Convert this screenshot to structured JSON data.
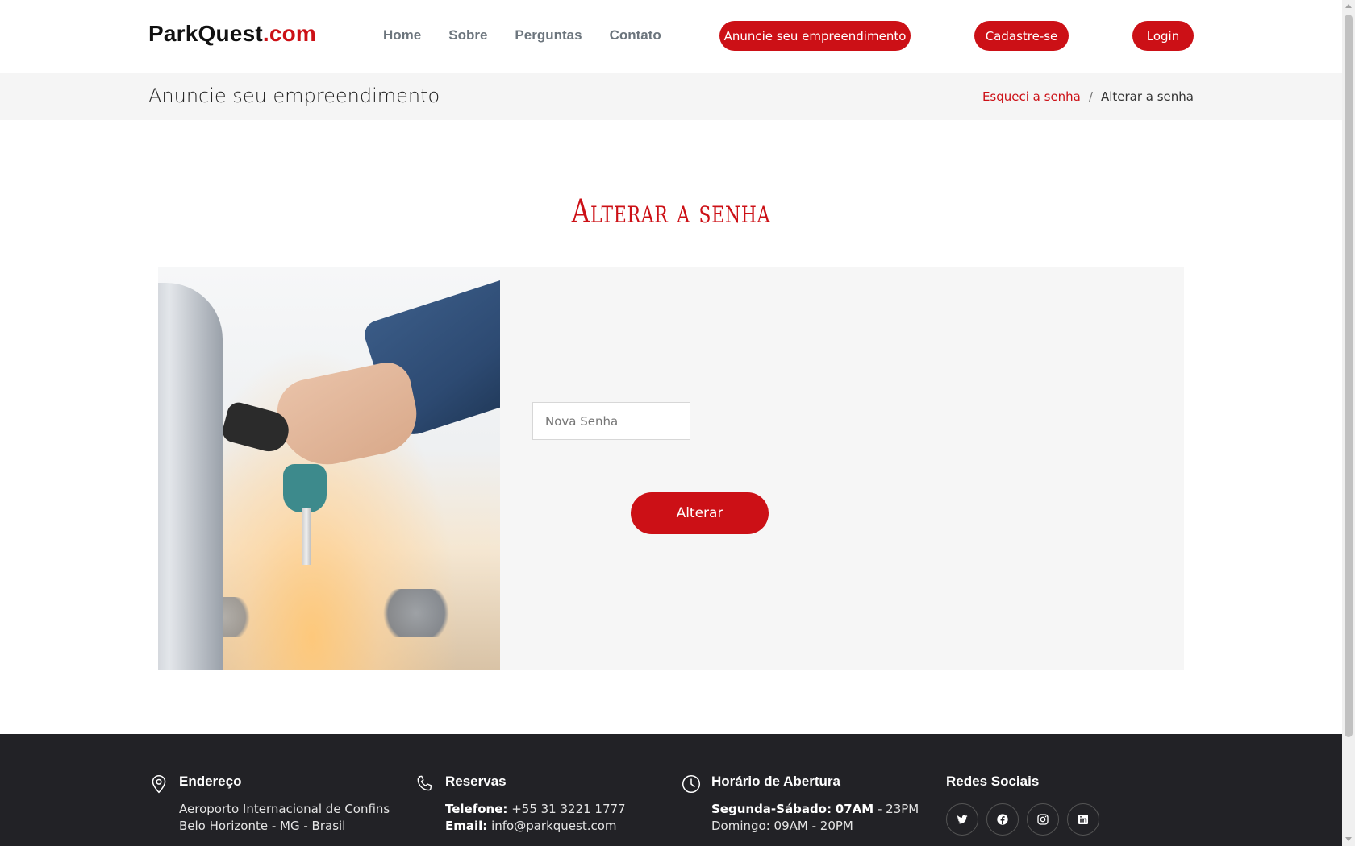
{
  "brand": {
    "name": "ParkQuest",
    "tld": ".com",
    "accent": "#cc1016"
  },
  "nav": {
    "items": [
      {
        "label": "Home"
      },
      {
        "label": "Sobre"
      },
      {
        "label": "Perguntas"
      },
      {
        "label": "Contato"
      }
    ],
    "anuncie_label": "Anuncie seu empreendimento",
    "cadastre_label": "Cadastre-se",
    "login_label": "Login"
  },
  "breadcrumb": {
    "page_title": "Anuncie seu empreendimento",
    "link": "Esqueci a senha",
    "separator": "/",
    "current": "Alterar a senha"
  },
  "main": {
    "title": "Alterar a senha",
    "password_placeholder": "Nova Senha",
    "password_value": "",
    "submit_label": "Alterar"
  },
  "footer": {
    "address": {
      "title": "Endereço",
      "line1": "Aeroporto Internacional de Confins",
      "line2": "Belo Horizonte - MG - Brasil",
      "icon": "map-pin-icon"
    },
    "reservations": {
      "title": "Reservas",
      "phone_label": "Telefone:",
      "phone": "+55 31 3221 1777",
      "email_label": "Email:",
      "email": "info@parkquest.com",
      "icon": "phone-icon"
    },
    "hours": {
      "title": "Horário de Abertura",
      "weekday_label": "Segunda-Sábado:",
      "weekday_open": "07AM",
      "weekday_close": "- 23PM",
      "sunday": "Domingo: 09AM - 20PM",
      "icon": "clock-icon"
    },
    "social": {
      "title": "Redes Sociais",
      "icons": [
        "twitter-icon",
        "facebook-icon",
        "instagram-icon",
        "linkedin-icon"
      ]
    }
  }
}
